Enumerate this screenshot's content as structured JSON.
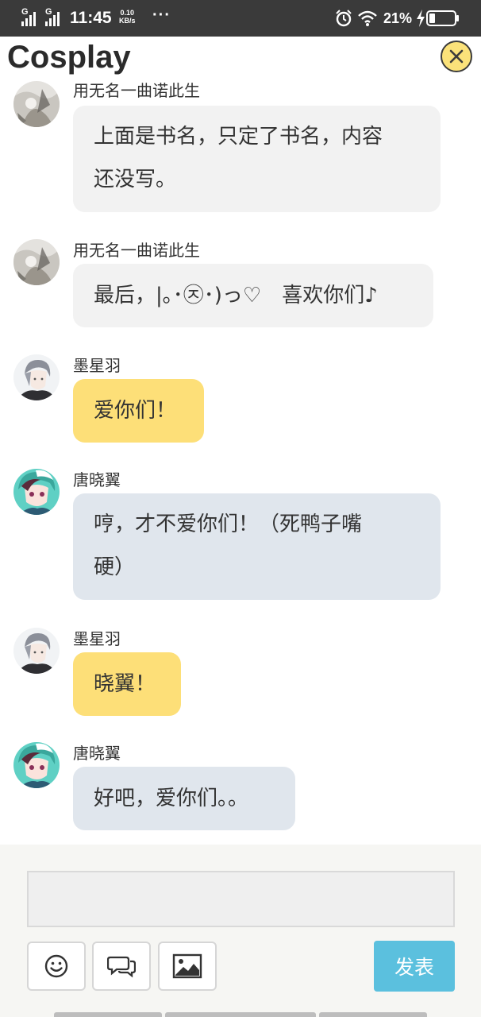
{
  "status_bar": {
    "network_1": "G",
    "network_2": "G",
    "time": "11:45",
    "speed_value": "0.10",
    "speed_unit": "KB/s",
    "overflow": "···",
    "battery_percent": "21%",
    "icons": [
      "signal-icon",
      "alarm-icon",
      "wifi-icon",
      "charging-icon",
      "battery-icon"
    ]
  },
  "header": {
    "title": "Cosplay",
    "close_icon": "close-icon",
    "close_color": "#fbe27a"
  },
  "messages": [
    {
      "sender": "用无名一曲诺此生",
      "lines": [
        "上面是书名，只定了书名，内容",
        "还没写。"
      ],
      "style": "white"
    },
    {
      "sender": "用无名一曲诺此生",
      "lines": [
        "最后，|｡･㉨･)っ♡　喜欢你们♪"
      ],
      "style": "white"
    },
    {
      "sender": "墨星羽",
      "lines": [
        "爱你们！"
      ],
      "style": "yellow"
    },
    {
      "sender": "唐晓翼",
      "lines": [
        "哼，才不爱你们！（死鸭子嘴",
        "硬）"
      ],
      "style": "blue"
    },
    {
      "sender": "墨星羽",
      "lines": [
        "晓翼！"
      ],
      "style": "yellow"
    },
    {
      "sender": "唐晓翼",
      "lines": [
        "好吧，爱你们。。"
      ],
      "style": "blue"
    }
  ],
  "input_bar": {
    "input_value": "",
    "tools": [
      "emoji-icon",
      "chat-bubbles-icon",
      "image-icon"
    ],
    "send_label": "发表",
    "send_color": "#5bc0de"
  },
  "colors": {
    "status_bar": "#3a3a3a",
    "bubble_white": "#f2f2f2",
    "bubble_yellow": "#fddf78",
    "bubble_blue": "#e0e6ed"
  }
}
